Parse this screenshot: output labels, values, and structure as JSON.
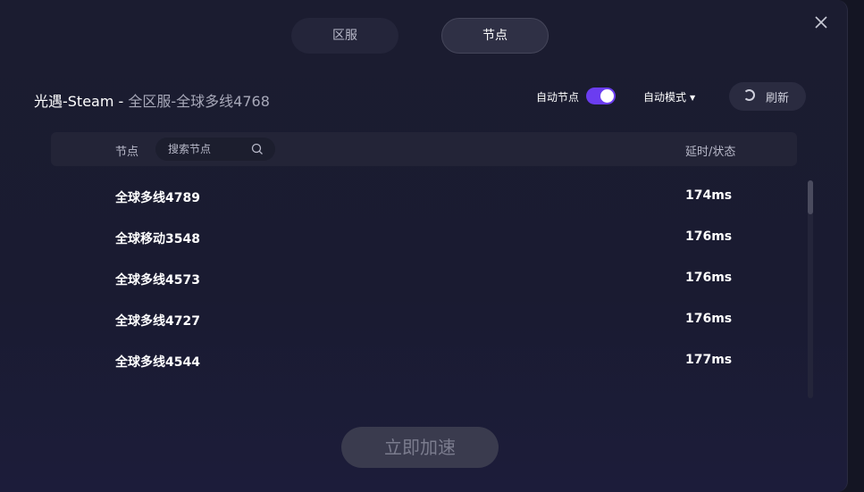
{
  "tabs": [
    {
      "label": "区服"
    },
    {
      "label": "节点"
    }
  ],
  "header": {
    "game": "光遇-Steam",
    "separator": " - ",
    "region_node": "全区服-全球多线4768",
    "auto_node_label": "自动节点",
    "auto_node_enabled": true,
    "mode_label": "自动模式",
    "refresh_label": "刷新"
  },
  "table": {
    "col_node": "节点",
    "search_placeholder": "搜索节点",
    "col_latency": "延时/状态",
    "rows": [
      {
        "name": "全球多线4789",
        "latency": "174ms"
      },
      {
        "name": "全球移动3548",
        "latency": "176ms"
      },
      {
        "name": "全球多线4573",
        "latency": "176ms"
      },
      {
        "name": "全球多线4727",
        "latency": "176ms"
      },
      {
        "name": "全球多线4544",
        "latency": "177ms"
      }
    ]
  },
  "accelerate_label": "立即加速",
  "colors": {
    "accent": "#6b3df0",
    "background": "#1b1c30"
  },
  "icons": {
    "close": "close-icon",
    "search": "search-icon",
    "refresh": "refresh-icon",
    "caret": "caret-down-icon"
  }
}
